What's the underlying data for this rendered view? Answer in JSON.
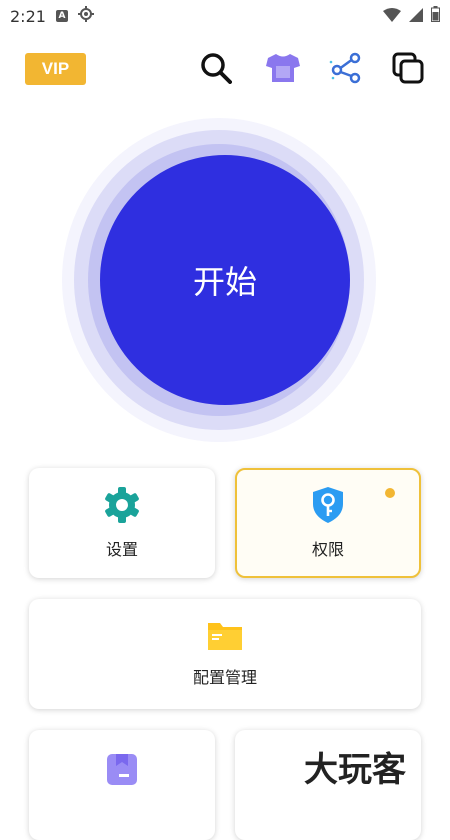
{
  "status_bar": {
    "time": "2:21",
    "notification_letter": "A"
  },
  "top_bar": {
    "vip_label": "VIP",
    "icons": [
      "search-icon",
      "tshirt-icon",
      "share-icon",
      "copy-icon"
    ]
  },
  "start": {
    "label": "开始"
  },
  "cards": {
    "settings": {
      "label": "设置",
      "icon": "gear-icon"
    },
    "permissions": {
      "label": "权限",
      "icon": "shield-key-icon"
    },
    "config": {
      "label": "配置管理",
      "icon": "folder-icon"
    }
  },
  "watermark": {
    "text": "大玩客"
  },
  "colors": {
    "accent": "#2f2fe0",
    "vip": "#f2b632",
    "teal": "#1aa39a",
    "blue_icon": "#2b9cf2",
    "folder": "#ffc21a"
  }
}
